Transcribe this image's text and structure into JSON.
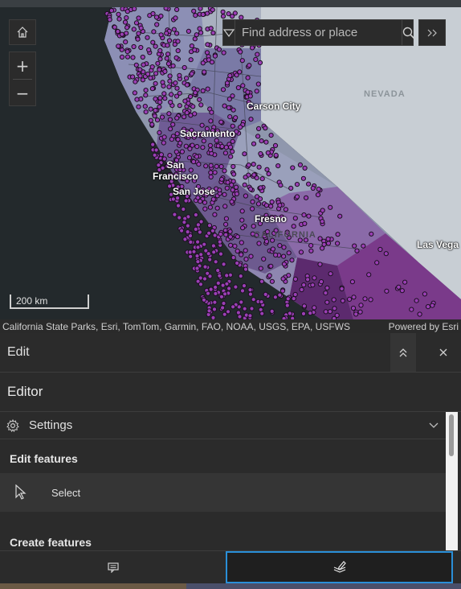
{
  "map": {
    "search_placeholder": "Find address or place",
    "labels": {
      "nevada": "NEVADA",
      "carson_city": "Carson City",
      "sacramento": "Sacramento",
      "san_francisco": "San\nFrancisco",
      "san_jose": "San Jose",
      "fresno": "Fresno",
      "california": "CALIFORNIA",
      "las_vegas": "Las Vega"
    },
    "scale": "200 km",
    "attribution": "California State Parks, Esri, TomTom, Garmin, FAO, NOAA, USGS, EPA, USFWS",
    "powered_by": "Powered by Esri",
    "icons": [
      "home-icon",
      "zoom-in-icon",
      "zoom-out-icon",
      "dropdown-icon",
      "search-icon",
      "expand-icon"
    ],
    "colors": {
      "point_fill": "#9b3fb5",
      "choropleth_dark": "#6a2c7a",
      "choropleth_mid": "#7c6f9b",
      "land_light": "#c7cdd3"
    }
  },
  "panel": {
    "title": "Edit",
    "editor_heading": "Editor",
    "settings_label": "Settings",
    "edit_features_heading": "Edit features",
    "select_label": "Select",
    "create_features_heading": "Create features",
    "icons": [
      "collapse-icon",
      "close-icon",
      "gear-icon",
      "chevron-down-icon",
      "cursor-icon",
      "comment-icon",
      "edit-layers-icon"
    ]
  }
}
